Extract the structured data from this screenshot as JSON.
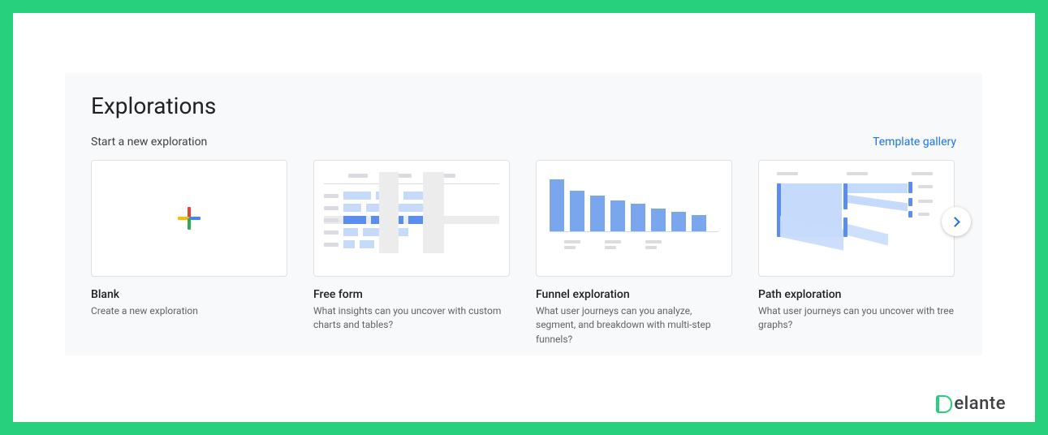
{
  "page": {
    "title": "Explorations",
    "subtitle": "Start a new exploration",
    "gallery_link": "Template gallery"
  },
  "cards": [
    {
      "title": "Blank",
      "desc": "Create a new exploration"
    },
    {
      "title": "Free form",
      "desc": "What insights can you uncover with custom charts and tables?"
    },
    {
      "title": "Funnel exploration",
      "desc": "What user journeys can you analyze, segment, and breakdown with multi-step funnels?"
    },
    {
      "title": "Path exploration",
      "desc": "What user journeys can you uncover with tree graphs?"
    }
  ],
  "branding": {
    "logo_rest": "elante"
  }
}
